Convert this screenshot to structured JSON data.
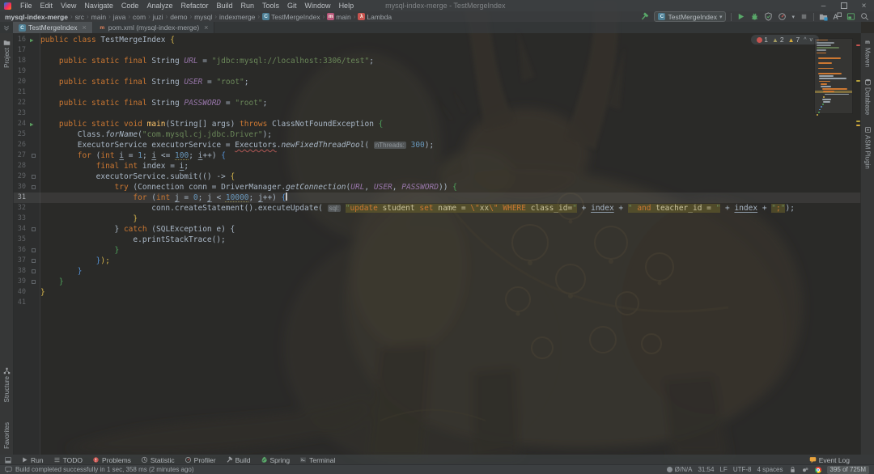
{
  "colors": {
    "accent_green": "#59a869",
    "error_red": "#c75450",
    "warning_yellow": "#d1a93f",
    "keyword": "#cc7832",
    "string": "#6a8759",
    "number": "#6897bb",
    "constant": "#9876aa",
    "injection_bg": "#69622a",
    "current_line_number_color": "#a8acb0"
  },
  "titlebar": {
    "title": "mysql-index-merge - TestMergeIndex",
    "menus": [
      "File",
      "Edit",
      "View",
      "Navigate",
      "Code",
      "Analyze",
      "Refactor",
      "Build",
      "Run",
      "Tools",
      "Git",
      "Window",
      "Help"
    ],
    "controls": {
      "minimize": "–",
      "close": "×"
    }
  },
  "navbar": {
    "crumbs": [
      {
        "label": "mysql-index-merge"
      },
      {
        "label": "src"
      },
      {
        "label": "main"
      },
      {
        "label": "java"
      },
      {
        "label": "com"
      },
      {
        "label": "juzi"
      },
      {
        "label": "demo"
      },
      {
        "label": "mysql"
      },
      {
        "label": "indexmerge"
      },
      {
        "label": "TestMergeIndex",
        "icon": "class"
      },
      {
        "label": "main",
        "icon": "method"
      },
      {
        "label": "Lambda",
        "icon": "lambda"
      }
    ],
    "run_config": "TestMergeIndex",
    "left_icon": "build-hammer",
    "icons": [
      "play",
      "debug",
      "coverage",
      "profiler",
      "stop",
      "project-structure",
      "translate",
      "tool-window-layout",
      "search"
    ]
  },
  "tabs": [
    {
      "label": "TestMergeIndex",
      "icon": "class",
      "close": "×",
      "active": true
    },
    {
      "label": "pom.xml (mysql-index-merge)",
      "icon": "maven",
      "close": "×",
      "active": false
    }
  ],
  "left_stripe": {
    "top": [
      {
        "label": "Project",
        "icon": "folder"
      }
    ],
    "bottom": [
      {
        "label": "Structure",
        "icon": "structure"
      },
      {
        "label": "Favorites",
        "icon": "star"
      }
    ]
  },
  "right_stripe": [
    {
      "label": "Maven",
      "icon": "maven"
    },
    {
      "label": "Database",
      "icon": "database"
    },
    {
      "label": "ASM Plugin",
      "icon": "plugin"
    }
  ],
  "inspections": {
    "errors": "1",
    "weak_warnings": "2",
    "warnings": "7"
  },
  "editor": {
    "lines": [
      {
        "no": 16,
        "run": true,
        "t": [
          [
            "k",
            "public"
          ],
          [
            "p",
            " "
          ],
          [
            "k",
            "class"
          ],
          [
            "p",
            " TestMergeIndex "
          ],
          [
            "bY",
            "{"
          ]
        ]
      },
      {
        "no": 17,
        "t": []
      },
      {
        "no": 18,
        "t": [
          [
            "p",
            "    "
          ],
          [
            "k",
            "public"
          ],
          [
            "p",
            " "
          ],
          [
            "k",
            "static"
          ],
          [
            "p",
            " "
          ],
          [
            "k",
            "final"
          ],
          [
            "p",
            " String "
          ],
          [
            "c",
            "URL"
          ],
          [
            "p",
            " = "
          ],
          [
            "s",
            "\"jdbc:mysql://localhost:3306/test\""
          ],
          [
            "p",
            ";"
          ]
        ]
      },
      {
        "no": 19,
        "t": []
      },
      {
        "no": 20,
        "t": [
          [
            "p",
            "    "
          ],
          [
            "k",
            "public"
          ],
          [
            "p",
            " "
          ],
          [
            "k",
            "static"
          ],
          [
            "p",
            " "
          ],
          [
            "k",
            "final"
          ],
          [
            "p",
            " String "
          ],
          [
            "c",
            "USER"
          ],
          [
            "p",
            " = "
          ],
          [
            "s",
            "\"root\""
          ],
          [
            "p",
            ";"
          ]
        ]
      },
      {
        "no": 21,
        "t": []
      },
      {
        "no": 22,
        "t": [
          [
            "p",
            "    "
          ],
          [
            "k",
            "public"
          ],
          [
            "p",
            " "
          ],
          [
            "k",
            "static"
          ],
          [
            "p",
            " "
          ],
          [
            "k",
            "final"
          ],
          [
            "p",
            " String "
          ],
          [
            "c",
            "PASSWORD"
          ],
          [
            "p",
            " = "
          ],
          [
            "s",
            "\"root\""
          ],
          [
            "p",
            ";"
          ]
        ]
      },
      {
        "no": 23,
        "t": []
      },
      {
        "no": 24,
        "run": true,
        "t": [
          [
            "p",
            "    "
          ],
          [
            "k",
            "public"
          ],
          [
            "p",
            " "
          ],
          [
            "k",
            "static"
          ],
          [
            "p",
            " "
          ],
          [
            "k",
            "void"
          ],
          [
            "p",
            " "
          ],
          [
            "m",
            "main"
          ],
          [
            "p",
            "(String[] args) "
          ],
          [
            "k",
            "throws"
          ],
          [
            "p",
            " ClassNotFoundException "
          ],
          [
            "bG",
            "{"
          ]
        ]
      },
      {
        "no": 25,
        "t": [
          [
            "p",
            "        Class."
          ],
          [
            "i",
            "forName"
          ],
          [
            "p",
            "("
          ],
          [
            "s",
            "\"com.mysql.cj.jdbc.Driver\""
          ],
          [
            "p",
            ");"
          ]
        ]
      },
      {
        "no": 26,
        "t": [
          [
            "p",
            "        ExecutorService executorService = "
          ],
          [
            "e",
            "Executors"
          ],
          [
            "p",
            "."
          ],
          [
            "i",
            "newFixedThreadPool"
          ],
          [
            "p",
            "( "
          ],
          [
            "h",
            "nThreads:"
          ],
          [
            "p",
            " "
          ],
          [
            "n",
            "300"
          ],
          [
            "p",
            ");"
          ]
        ]
      },
      {
        "no": 27,
        "fold": true,
        "t": [
          [
            "p",
            "        "
          ],
          [
            "k",
            "for"
          ],
          [
            "p",
            " ("
          ],
          [
            "k",
            "int"
          ],
          [
            "p",
            " "
          ],
          [
            "u",
            "i"
          ],
          [
            "p",
            " = "
          ],
          [
            "n",
            "1"
          ],
          [
            "p",
            "; "
          ],
          [
            "u",
            "i"
          ],
          [
            "p",
            " <= "
          ],
          [
            "nw",
            "100"
          ],
          [
            "p",
            "; "
          ],
          [
            "u",
            "i"
          ],
          [
            "p",
            "++) "
          ],
          [
            "bB",
            "{"
          ]
        ]
      },
      {
        "no": 28,
        "t": [
          [
            "p",
            "            "
          ],
          [
            "k",
            "final"
          ],
          [
            "p",
            " "
          ],
          [
            "k",
            "int"
          ],
          [
            "p",
            " index = "
          ],
          [
            "u",
            "i"
          ],
          [
            "p",
            ";"
          ]
        ]
      },
      {
        "no": 29,
        "fold": true,
        "t": [
          [
            "p",
            "            executorService.submit(() -> "
          ],
          [
            "bY",
            "{"
          ]
        ]
      },
      {
        "no": 30,
        "fold": true,
        "t": [
          [
            "p",
            "                "
          ],
          [
            "k",
            "try"
          ],
          [
            "p",
            " (Connection conn = DriverManager."
          ],
          [
            "i",
            "getConnection"
          ],
          [
            "p",
            "("
          ],
          [
            "c",
            "URL"
          ],
          [
            "p",
            ", "
          ],
          [
            "c",
            "USER"
          ],
          [
            "p",
            ", "
          ],
          [
            "c",
            "PASSWORD"
          ],
          [
            "p",
            ")) "
          ],
          [
            "bG",
            "{"
          ]
        ]
      },
      {
        "no": 31,
        "cur": true,
        "t": [
          [
            "p",
            "                    "
          ],
          [
            "k",
            "for"
          ],
          [
            "p",
            " ("
          ],
          [
            "k",
            "int"
          ],
          [
            "p",
            " "
          ],
          [
            "u",
            "j"
          ],
          [
            "p",
            " = "
          ],
          [
            "n",
            "0"
          ],
          [
            "p",
            "; "
          ],
          [
            "u",
            "j"
          ],
          [
            "p",
            " < "
          ],
          [
            "nw",
            "10000"
          ],
          [
            "p",
            "; "
          ],
          [
            "u",
            "j"
          ],
          [
            "p",
            "++) "
          ],
          [
            "bB",
            "{"
          ],
          [
            "caret",
            ""
          ]
        ]
      },
      {
        "no": 32,
        "t": [
          [
            "p",
            "                        conn.createStatement().executeUpdate( "
          ],
          [
            "h",
            "sql:"
          ],
          [
            "p",
            " "
          ],
          [
            "qs",
            "\""
          ],
          [
            "qk",
            "update"
          ],
          [
            "qp",
            " student "
          ],
          [
            "qk",
            "set"
          ],
          [
            "qp",
            " name = "
          ],
          [
            "qe",
            "\\\""
          ],
          [
            "qp",
            "xx"
          ],
          [
            "qe",
            "\\\""
          ],
          [
            "qp",
            " "
          ],
          [
            "qk",
            "WHERE"
          ],
          [
            "qp",
            " class_id="
          ],
          [
            "qs",
            "\""
          ],
          [
            "p",
            " + "
          ],
          [
            "u",
            "index"
          ],
          [
            "p",
            " + "
          ],
          [
            "qs",
            "\" "
          ],
          [
            "qk",
            "and"
          ],
          [
            "qp",
            " teacher_id = "
          ],
          [
            "qs",
            "\""
          ],
          [
            "p",
            " + "
          ],
          [
            "u",
            "index"
          ],
          [
            "p",
            " + "
          ],
          [
            "qs",
            "\""
          ],
          [
            "qk",
            ";"
          ],
          [
            "qs",
            "\""
          ],
          [
            "p",
            ");"
          ]
        ]
      },
      {
        "no": 33,
        "t": [
          [
            "p",
            "                    "
          ],
          [
            "bY",
            "}"
          ]
        ]
      },
      {
        "no": 34,
        "fold": true,
        "t": [
          [
            "p",
            "                } "
          ],
          [
            "k",
            "catch"
          ],
          [
            "p",
            " (SQLException e) {"
          ]
        ]
      },
      {
        "no": 35,
        "t": [
          [
            "p",
            "                    e.printStackTrace();"
          ]
        ]
      },
      {
        "no": 36,
        "fold": true,
        "t": [
          [
            "p",
            "                "
          ],
          [
            "bG",
            "}"
          ]
        ]
      },
      {
        "no": 37,
        "fold": true,
        "t": [
          [
            "p",
            "            "
          ],
          [
            "bB",
            "}"
          ],
          [
            "bY",
            ");"
          ]
        ]
      },
      {
        "no": 38,
        "fold": true,
        "t": [
          [
            "p",
            "        "
          ],
          [
            "bB",
            "}"
          ]
        ]
      },
      {
        "no": 39,
        "fold": true,
        "t": [
          [
            "p",
            "    "
          ],
          [
            "bG",
            "}"
          ]
        ]
      },
      {
        "no": 40,
        "t": [
          [
            "bY",
            "}"
          ]
        ]
      },
      {
        "no": 41,
        "t": []
      }
    ]
  },
  "bottombar": {
    "tools": [
      {
        "label": "Run",
        "icon": "run"
      },
      {
        "label": "TODO",
        "icon": "todo"
      },
      {
        "label": "Problems",
        "icon": "problems"
      },
      {
        "label": "Statistic",
        "icon": "statistic"
      },
      {
        "label": "Profiler",
        "icon": "profiler"
      },
      {
        "label": "Build",
        "icon": "build"
      },
      {
        "label": "Spring",
        "icon": "spring"
      },
      {
        "label": "Terminal",
        "icon": "terminal"
      }
    ],
    "event_log": {
      "label": "Event Log",
      "icon": "event-log"
    }
  },
  "statusbar": {
    "message": "Build completed successfully in 1 sec, 358 ms (2 minutes ago)",
    "message_icon": "balloon",
    "items": [
      {
        "label": "Ø/N/A",
        "icon": "status-circle"
      },
      {
        "label": "31:54"
      },
      {
        "label": "LF"
      },
      {
        "label": "UTF-8"
      },
      {
        "label": "4 spaces"
      },
      {
        "icon": "lock"
      },
      {
        "icon": "reader-mode"
      },
      {
        "icon": "chrome"
      }
    ],
    "memory": "395 of 725M"
  }
}
